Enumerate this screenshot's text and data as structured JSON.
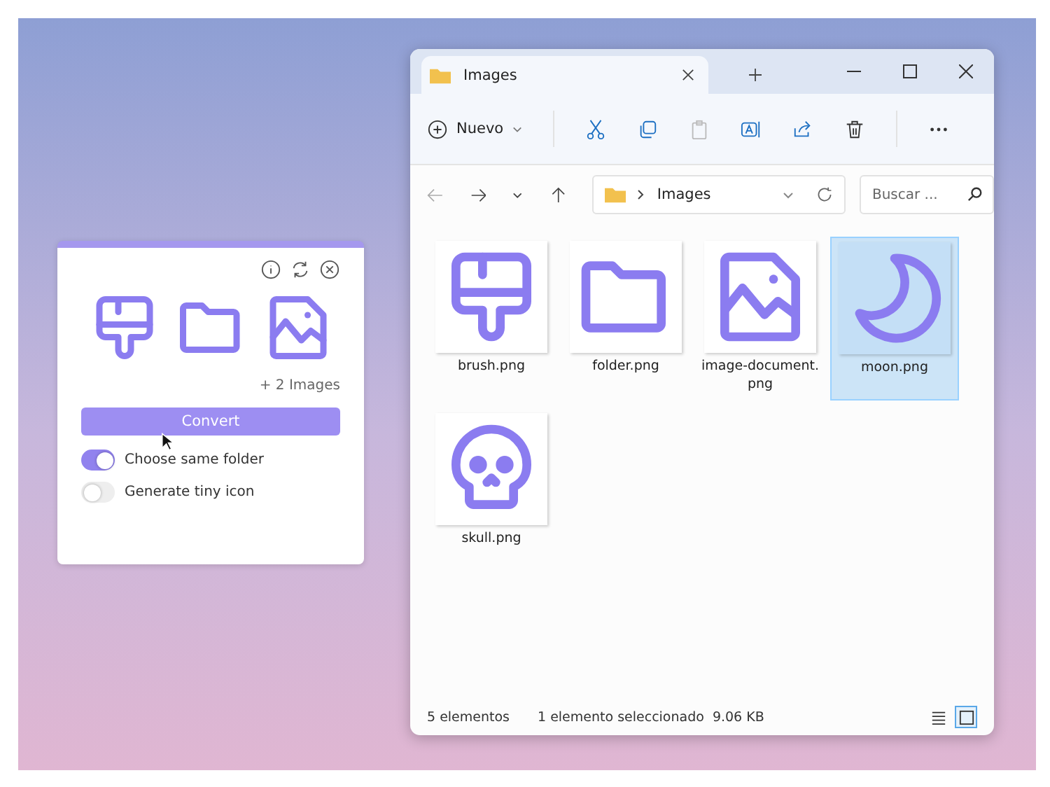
{
  "converter": {
    "icons": [
      {
        "kind": "brush"
      },
      {
        "kind": "folder"
      },
      {
        "kind": "image"
      }
    ],
    "more": "+ 2 Images",
    "button": "Convert",
    "toggles": [
      {
        "label": "Choose same folder",
        "on": true
      },
      {
        "label": "Generate tiny icon",
        "on": false
      }
    ]
  },
  "explorer": {
    "tabs": [
      {
        "title": "Images",
        "selected": true
      }
    ],
    "new_button": "Nuevo",
    "address": "Images",
    "search": {
      "placeholder": "Buscar ..."
    },
    "files": [
      {
        "name": "brush.png",
        "kind": "brush",
        "selected": false
      },
      {
        "name": "folder.png",
        "kind": "folder",
        "selected": false
      },
      {
        "name": "image-document.png",
        "kind": "image",
        "selected": false
      },
      {
        "name": "moon.png",
        "kind": "moon",
        "selected": true
      },
      {
        "name": "skull.png",
        "kind": "skull",
        "selected": false
      }
    ],
    "status_bar": {
      "count": "5 elementos",
      "selection": "1 elemento seleccionado",
      "size": "9.06 KB"
    },
    "views": [
      {
        "kind": "details",
        "selected": false
      },
      {
        "kind": "tiles",
        "selected": true
      }
    ]
  }
}
